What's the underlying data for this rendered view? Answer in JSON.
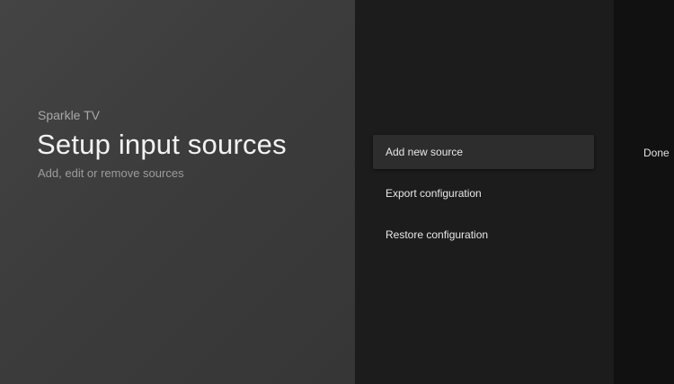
{
  "header": {
    "app_name": "Sparkle TV",
    "title": "Setup input sources",
    "subtitle": "Add, edit or remove sources"
  },
  "actions": [
    {
      "label": "Add new source",
      "focused": true
    },
    {
      "label": "Export configuration",
      "focused": false
    },
    {
      "label": "Restore configuration",
      "focused": false
    }
  ],
  "secondary_actions": {
    "done_label": "Done"
  },
  "colors": {
    "left_panel": "#3e3e3e",
    "middle_panel": "#1c1c1c",
    "right_panel": "#111111",
    "focused_item": "#2d2d2d",
    "title_text": "#f2f2f2",
    "secondary_text": "#a9a9a9"
  }
}
